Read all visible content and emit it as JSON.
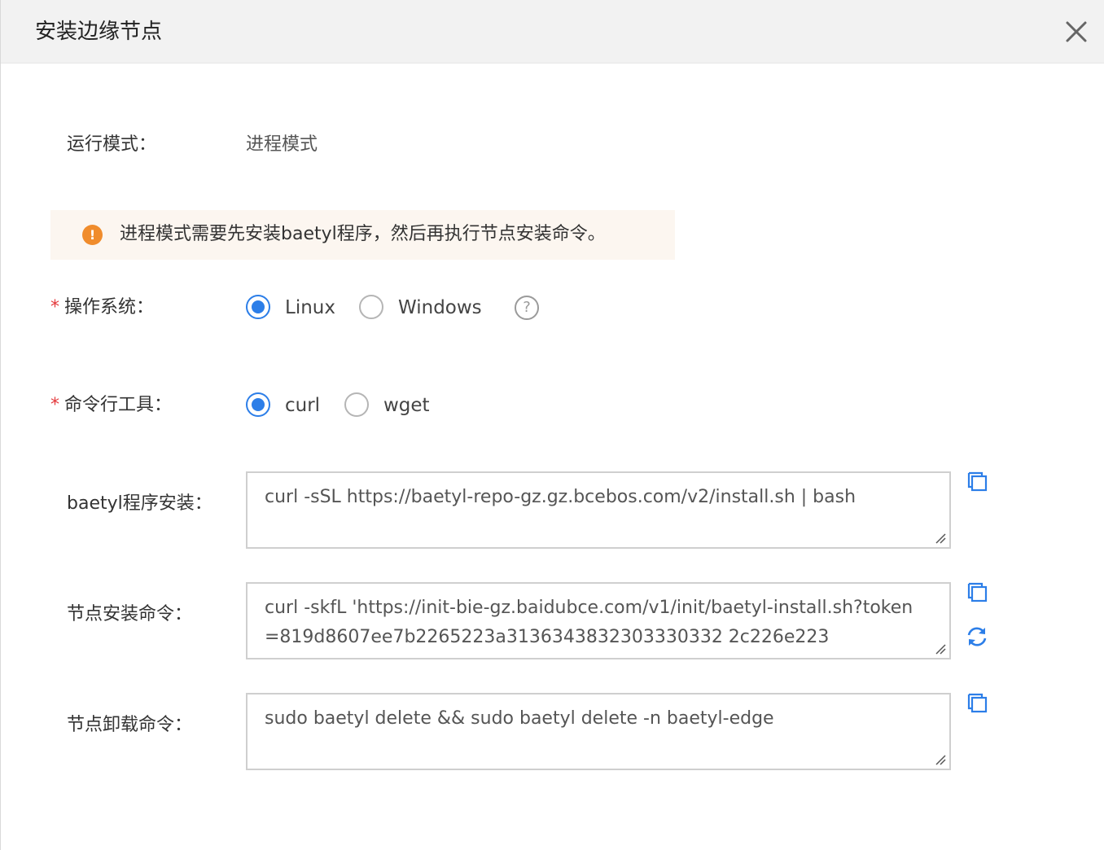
{
  "dialog": {
    "title": "安装边缘节点",
    "close_icon": "close-icon"
  },
  "run_mode": {
    "label": "运行模式：",
    "value": "进程模式"
  },
  "notice": {
    "icon": "warning-icon",
    "icon_glyph": "!",
    "text": "进程模式需要先安装baetyl程序，然后再执行节点安装命令。",
    "color": "#f08c2c"
  },
  "os": {
    "required_mark": "*",
    "label": "操作系统：",
    "options": [
      {
        "label": "Linux",
        "checked": true
      },
      {
        "label": "Windows",
        "checked": false
      }
    ],
    "help_glyph": "?"
  },
  "cli_tool": {
    "required_mark": "*",
    "label": "命令行工具：",
    "options": [
      {
        "label": "curl",
        "checked": true
      },
      {
        "label": "wget",
        "checked": false
      }
    ]
  },
  "baetyl_install": {
    "label": "baetyl程序安装：",
    "command": "curl -sSL https://baetyl-repo-gz.gz.bcebos.com/v2/install.sh | bash",
    "copy_icon": "copy-icon"
  },
  "node_install": {
    "label": "节点安装命令：",
    "command": "curl -skfL 'https://init-bie-gz.baidubce.com/v1/init/baetyl-install.sh?token=819d8607ee7b2265223a3136343832303330332 2c226e223",
    "copy_icon": "copy-icon",
    "refresh_icon": "refresh-icon"
  },
  "node_uninstall": {
    "label": "节点卸载命令：",
    "command": "sudo baetyl delete && sudo baetyl delete -n baetyl-edge",
    "copy_icon": "copy-icon"
  },
  "colors": {
    "accent": "#2c7ee8",
    "required": "#e4393c",
    "notice_bg": "#fcf6f0"
  }
}
